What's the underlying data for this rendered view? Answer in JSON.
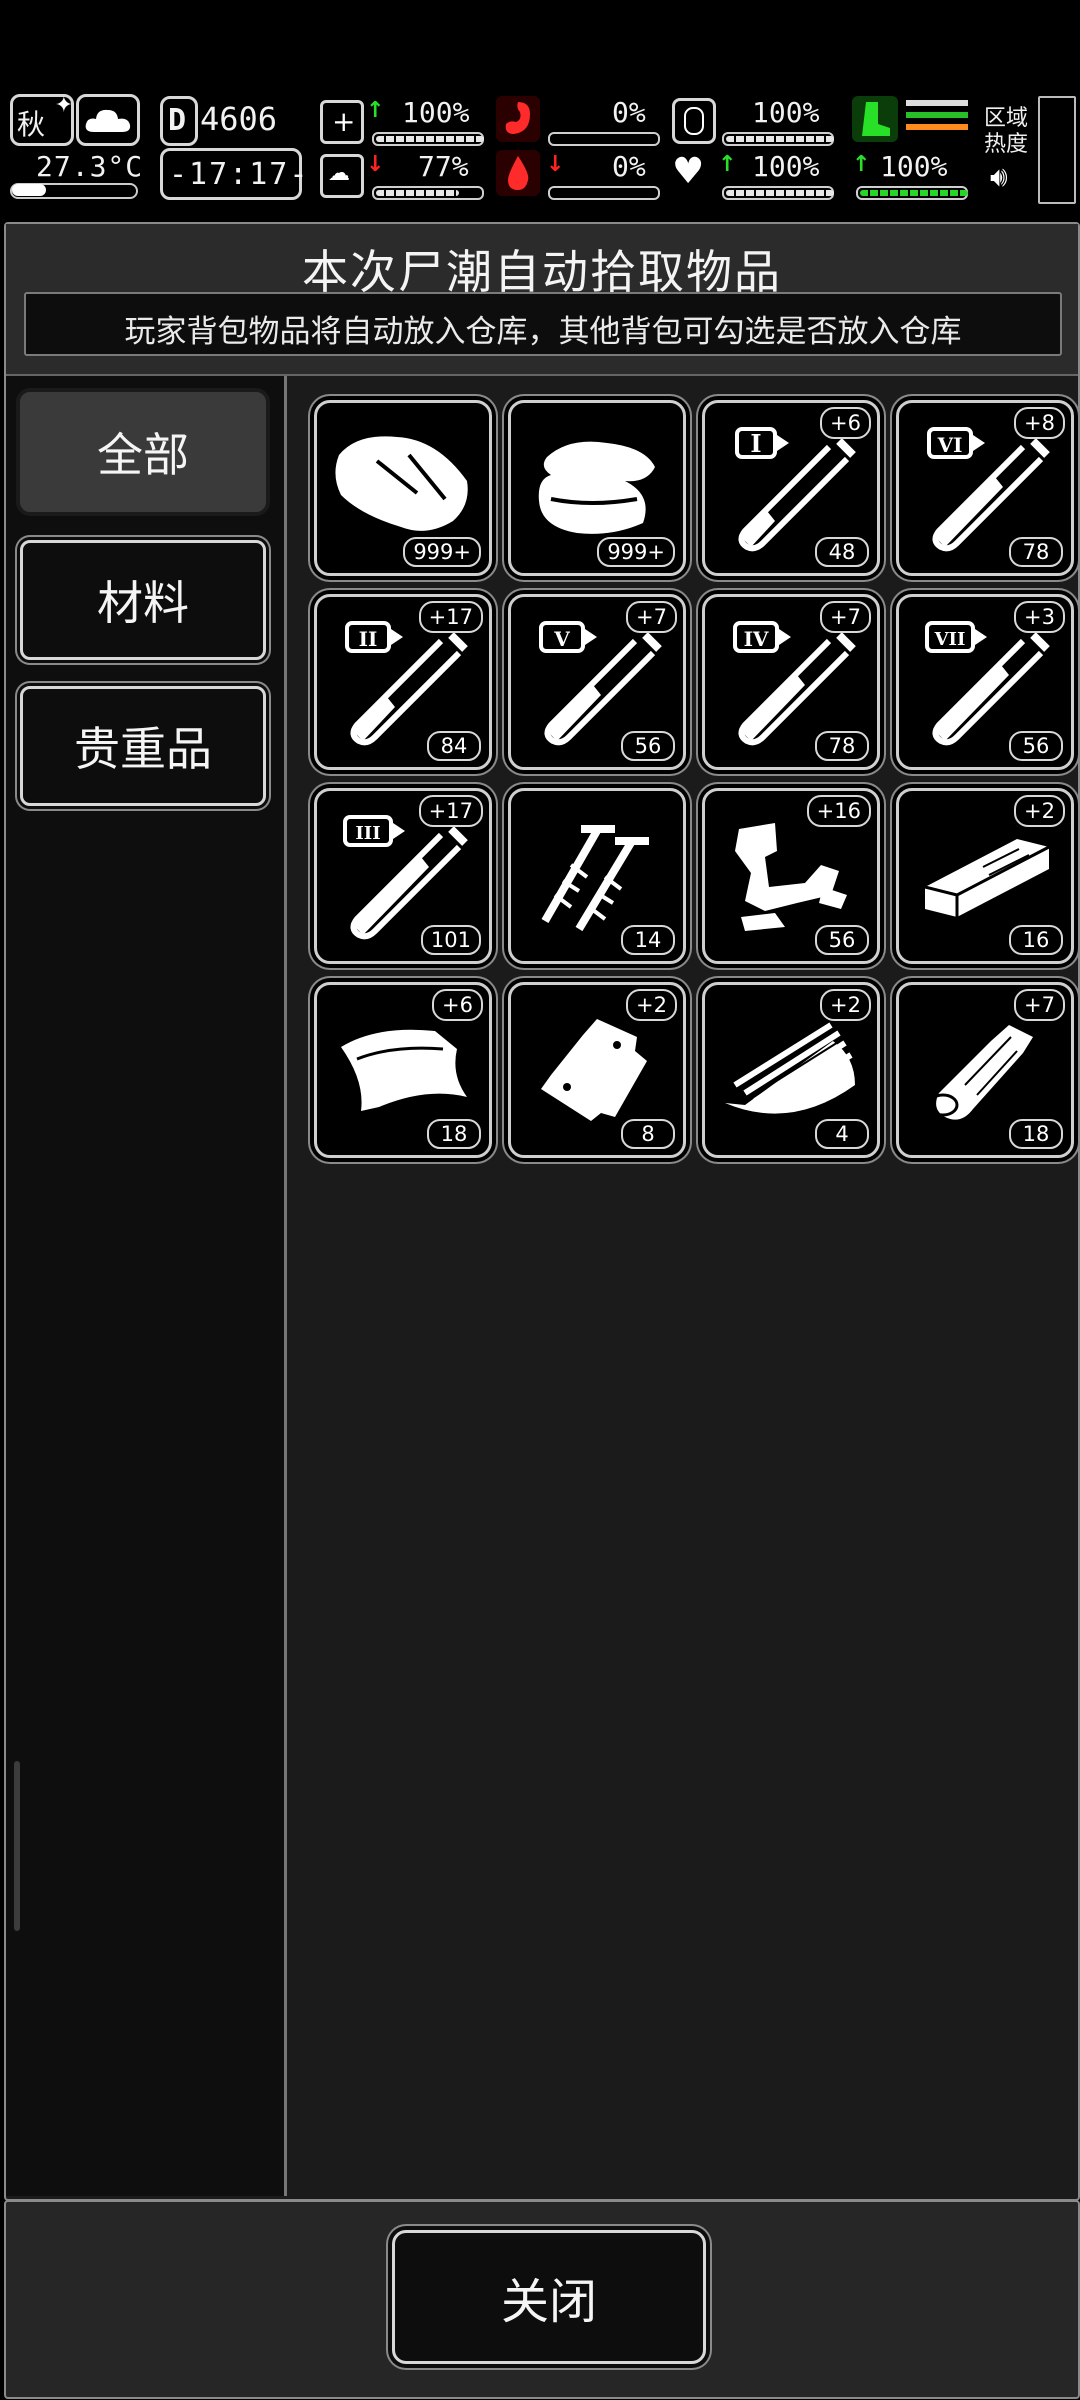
{
  "status_bar": {
    "season": "秋",
    "temperature": "27.3°C",
    "day": "4606",
    "day_icon": "D",
    "time": "-17:17-",
    "health": "100%",
    "mood": "77%",
    "hunger": "0%",
    "thirst": "0%",
    "stamina": "100%",
    "heart": "100%",
    "energy": "100%",
    "region_heat_label": "区域热度",
    "icons": [
      "leaf-icon",
      "cloud-icon",
      "medkit-icon",
      "brain-icon",
      "stomach-icon",
      "water-drop-icon",
      "pill-icon",
      "heart-icon",
      "boot-icon",
      "speaker-icon"
    ],
    "colors": {
      "up": "#28e028",
      "down": "#ff2222",
      "accent_red": "#ff2222"
    }
  },
  "panel": {
    "title": "本次尸潮自动拾取物品",
    "subtitle": "玩家背包物品将自动放入仓库，其他背包可勾选是否放入仓库"
  },
  "tabs": [
    {
      "label": "全部",
      "active": true
    },
    {
      "label": "材料",
      "active": false
    },
    {
      "label": "贵重品",
      "active": false
    }
  ],
  "items": [
    {
      "icon": "meat-icon",
      "count": "999+",
      "bonus": ""
    },
    {
      "icon": "cloth-icon",
      "count": "999+",
      "bonus": ""
    },
    {
      "icon": "syringe-i-icon",
      "tier": "I",
      "count": "48",
      "bonus": "+6"
    },
    {
      "icon": "syringe-vi-icon",
      "tier": "VI",
      "count": "78",
      "bonus": "+8"
    },
    {
      "icon": "syringe-ii-icon",
      "tier": "II",
      "count": "84",
      "bonus": "+17"
    },
    {
      "icon": "syringe-v-icon",
      "tier": "V",
      "count": "56",
      "bonus": "+7"
    },
    {
      "icon": "syringe-iv-icon",
      "tier": "IV",
      "count": "78",
      "bonus": "+7"
    },
    {
      "icon": "syringe-vii-icon",
      "tier": "VII",
      "count": "56",
      "bonus": "+3"
    },
    {
      "icon": "syringe-iii-icon",
      "tier": "III",
      "count": "101",
      "bonus": "+17"
    },
    {
      "icon": "screws-icon",
      "count": "14",
      "bonus": ""
    },
    {
      "icon": "scrap-metal-icon",
      "count": "56",
      "bonus": "+16"
    },
    {
      "icon": "board-icon",
      "count": "16",
      "bonus": "+2"
    },
    {
      "icon": "leather-icon",
      "count": "18",
      "bonus": "+6"
    },
    {
      "icon": "pouch-icon",
      "count": "8",
      "bonus": "+2"
    },
    {
      "icon": "fibers-icon",
      "count": "4",
      "bonus": "+2"
    },
    {
      "icon": "log-icon",
      "count": "18",
      "bonus": "+7"
    }
  ],
  "footer": {
    "close_label": "关闭"
  }
}
